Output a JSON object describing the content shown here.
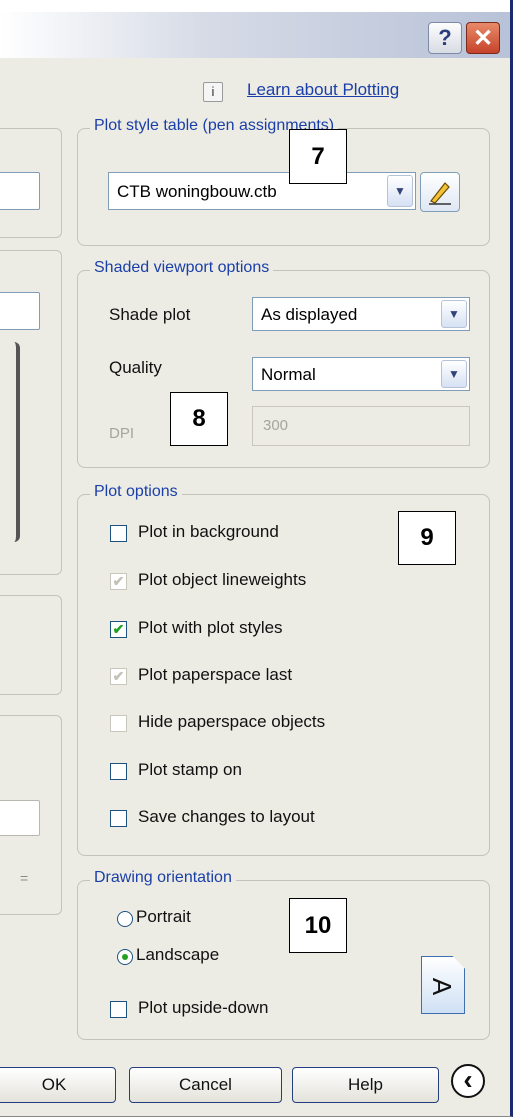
{
  "title_bar": {
    "help_label": "?",
    "close_label": "✕"
  },
  "learn": {
    "info_glyph": "i",
    "label": "Learn about Plotting"
  },
  "plot_style_table": {
    "legend": "Plot style table (pen assignments)",
    "selected": "CTB woningbouw.ctb",
    "edit_icon": "pencil-edit-icon"
  },
  "shaded_viewport": {
    "legend": "Shaded viewport options",
    "shade_plot_label": "Shade plot",
    "shade_plot_value": "As displayed",
    "quality_label": "Quality",
    "quality_value": "Normal",
    "dpi_label": "DPI",
    "dpi_value": "300"
  },
  "plot_options": {
    "legend": "Plot options",
    "items": [
      {
        "label": "Plot in background",
        "checked": false,
        "enabled": true
      },
      {
        "label": "Plot object lineweights",
        "checked": true,
        "enabled": false
      },
      {
        "label": "Plot with plot styles",
        "checked": true,
        "enabled": true
      },
      {
        "label": "Plot paperspace last",
        "checked": true,
        "enabled": false
      },
      {
        "label": "Hide paperspace objects",
        "checked": false,
        "enabled": false
      },
      {
        "label": "Plot stamp on",
        "checked": false,
        "enabled": true
      },
      {
        "label": "Save changes to layout",
        "checked": false,
        "enabled": true
      }
    ]
  },
  "orientation": {
    "legend": "Drawing orientation",
    "portrait": "Portrait",
    "landscape": "Landscape",
    "selected": "landscape",
    "upside_down": "Plot upside-down",
    "upside_down_checked": false,
    "orientation_glyph": "A"
  },
  "callouts": [
    "7",
    "8",
    "9",
    "10"
  ],
  "buttons": {
    "ok": "OK",
    "cancel": "Cancel",
    "help": "Help",
    "collapse_glyph": "‹"
  },
  "colors": {
    "accent": "#1b3fa8",
    "check_green": "#21a121",
    "face": "#ecebe4"
  }
}
